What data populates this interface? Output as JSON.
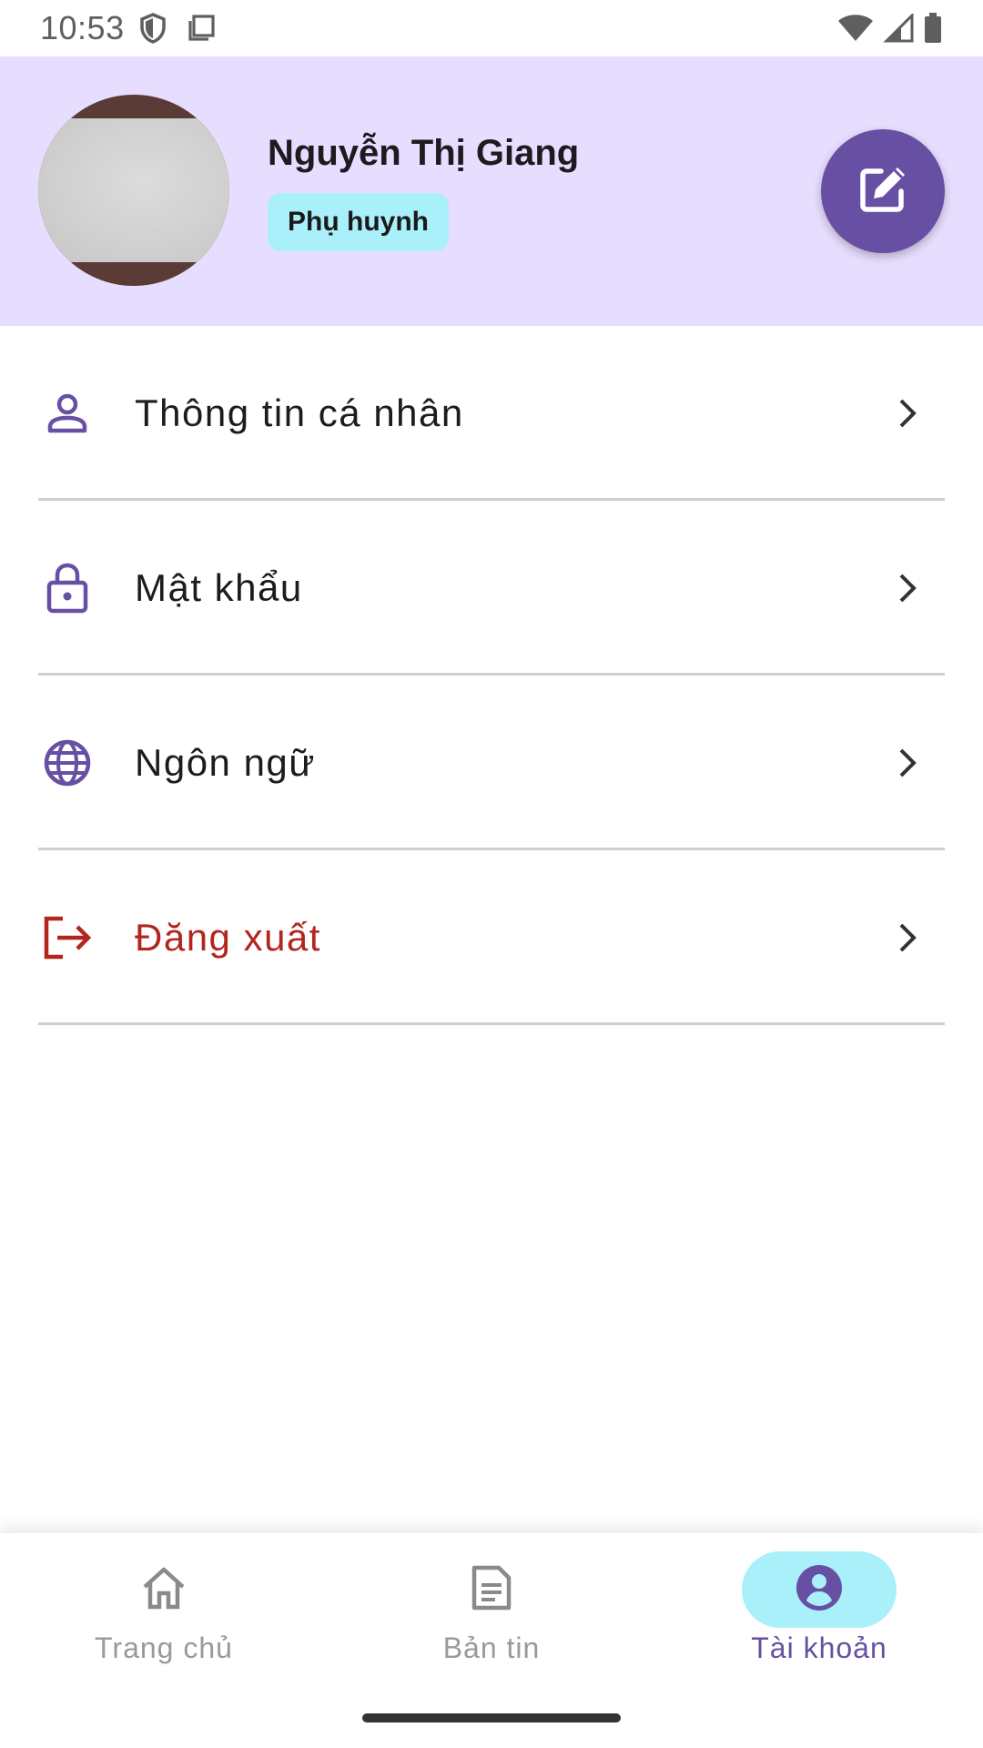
{
  "status_bar": {
    "time": "10:53",
    "left_icons": [
      "shield-icon",
      "clipboard-icon"
    ],
    "right_icons": [
      "wifi-icon",
      "signal-icon",
      "battery-icon"
    ]
  },
  "profile": {
    "name": "Nguyễn Thị Giang",
    "role": "Phụ huynh",
    "header_color": "#e7ddfe",
    "badge_color": "#aaf0fb",
    "edit_button_color": "#6750a4",
    "edit_icon": "edit-icon"
  },
  "menu": {
    "items": [
      {
        "label": "Thông tin cá nhân",
        "icon": "person-icon"
      },
      {
        "label": "Mật khẩu",
        "icon": "lock-icon"
      },
      {
        "label": "Ngôn ngữ",
        "icon": "globe-icon"
      },
      {
        "label": "Đăng xuất",
        "icon": "logout-icon",
        "color": "#b3261e"
      }
    ]
  },
  "bottom_nav": {
    "items": [
      {
        "label": "Trang chủ",
        "icon": "home-icon",
        "active": false
      },
      {
        "label": "Bản tin",
        "icon": "news-icon",
        "active": false
      },
      {
        "label": "Tài khoản",
        "icon": "account-icon",
        "active": true
      }
    ],
    "active_color": "#6750a4",
    "active_pill_color": "#aaf0fb"
  }
}
